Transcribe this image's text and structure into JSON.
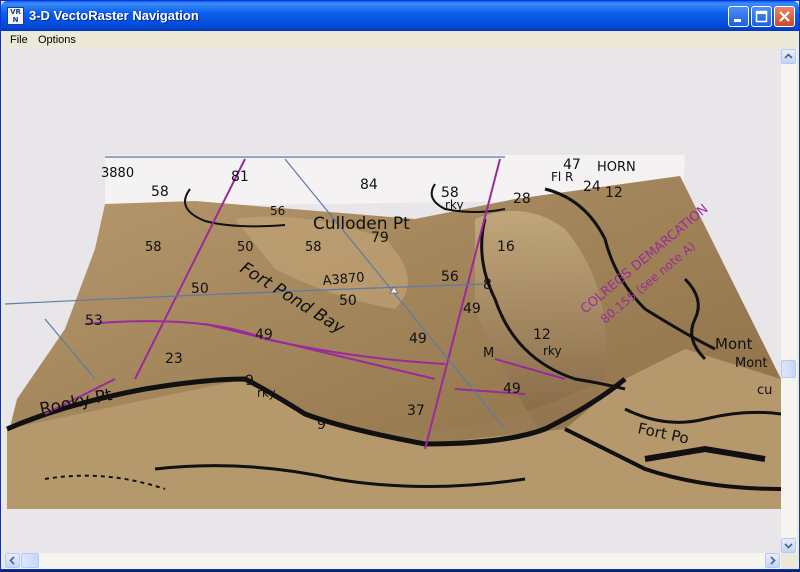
{
  "window": {
    "icon_text_top": "VR",
    "icon_text_bottom": "N",
    "title": "3-D VectoRaster Navigation"
  },
  "menu": {
    "items": [
      {
        "label": "File"
      },
      {
        "label": "Options"
      }
    ]
  },
  "map": {
    "labels_black": [
      "3880",
      "81",
      "84",
      "58",
      "56",
      "58",
      "47",
      "HORN",
      "Fl R",
      "58",
      "rky",
      "28",
      "24",
      "12",
      "Culloden Pt",
      "79",
      "58",
      "50",
      "58",
      "16",
      "A3870",
      "56",
      "8",
      "50",
      "Fort Pond Bay",
      "50",
      "49",
      "53",
      "49",
      "49",
      "12",
      "M",
      "rky",
      "23",
      "9",
      "49",
      "rky",
      "Rooky Pt",
      "37",
      "9",
      "Fort Po",
      "Mont",
      "Mont",
      "cu"
    ],
    "labels_magenta": [
      "COLREGS DEMARCATION",
      "80.155 (see note A)"
    ],
    "colors": {
      "background": "#e9e6ea",
      "terrain_light": "#c9ae85",
      "terrain_dark": "#6e5535",
      "ink": "#111111",
      "magenta": "#9b2a9b",
      "blue_line": "#5a7aa8"
    }
  },
  "scrollbars": {
    "vertical_icons": [
      "scroll-up-icon",
      "scroll-down-icon"
    ],
    "horizontal_icons": [
      "scroll-left-icon",
      "scroll-right-icon"
    ]
  }
}
